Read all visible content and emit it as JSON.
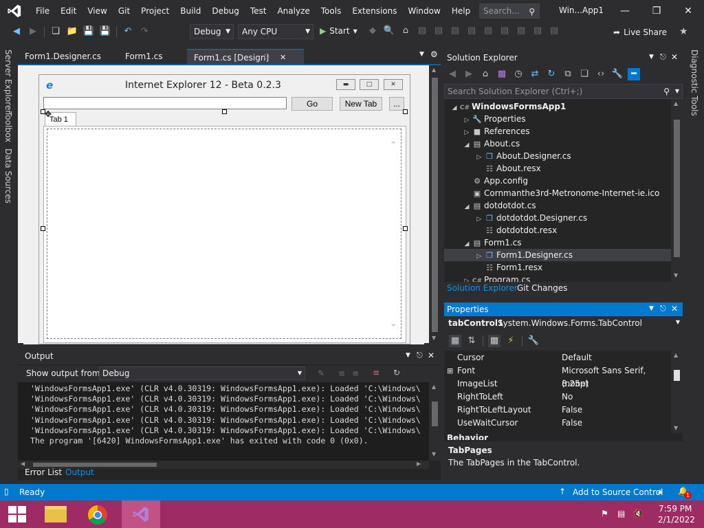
{
  "menubar": {
    "items": [
      "File",
      "Edit",
      "View",
      "Git",
      "Project",
      "Build",
      "Debug",
      "Test",
      "Analyze",
      "Tools",
      "Extensions",
      "Window",
      "Help"
    ],
    "search_placeholder": "Search...",
    "window_title": "Win...App1"
  },
  "toolbar": {
    "config": "Debug",
    "platform": "Any CPU",
    "start_label": "Start",
    "live_share": "Live Share"
  },
  "left_strip": [
    "Server Explorer",
    "Toolbox",
    "Data Sources"
  ],
  "right_strip": "Diagnostic Tools",
  "doc_tabs": [
    "Form1.Designer.cs",
    "Form1.cs",
    "Form1.cs [Design]"
  ],
  "ie_form": {
    "title": "Internet Explorer 12 - Beta 0.2.3",
    "go_label": "Go",
    "newtab_label": "New Tab",
    "more_label": "...",
    "tab1_label": "Tab 1"
  },
  "output": {
    "title": "Output",
    "show_from_label": "Show output from:",
    "source": "Debug",
    "lines": [
      "'WindowsFormsApp1.exe' (CLR v4.0.30319: WindowsFormsApp1.exe): Loaded 'C:\\Windows\\",
      "'WindowsFormsApp1.exe' (CLR v4.0.30319: WindowsFormsApp1.exe): Loaded 'C:\\Windows\\",
      "'WindowsFormsApp1.exe' (CLR v4.0.30319: WindowsFormsApp1.exe): Loaded 'C:\\Windows\\",
      "'WindowsFormsApp1.exe' (CLR v4.0.30319: WindowsFormsApp1.exe): Loaded 'C:\\Windows\\",
      "'WindowsFormsApp1.exe' (CLR v4.0.30319: WindowsFormsApp1.exe): Loaded 'C:\\Windows\\",
      "The program '[6420] WindowsFormsApp1.exe' has exited with code 0 (0x0)."
    ],
    "bottom_tabs": [
      "Error List",
      "Output"
    ]
  },
  "solution_explorer": {
    "title": "Solution Explorer",
    "search_placeholder": "Search Solution Explorer (Ctrl+;)",
    "tree": [
      {
        "label": "WindowsFormsApp1",
        "level": 0,
        "exp": "down",
        "icon": "C#",
        "bold": true
      },
      {
        "label": "Properties",
        "level": 1,
        "exp": "right",
        "icon": "wrench"
      },
      {
        "label": "References",
        "level": 1,
        "exp": "right",
        "icon": "refs"
      },
      {
        "label": "About.cs",
        "level": 1,
        "exp": "down",
        "icon": "form"
      },
      {
        "label": "About.Designer.cs",
        "level": 2,
        "exp": "right",
        "icon": "cs"
      },
      {
        "label": "About.resx",
        "level": 2,
        "exp": "",
        "icon": "resx"
      },
      {
        "label": "App.config",
        "level": 1,
        "exp": "",
        "icon": "config"
      },
      {
        "label": "Cornmanthe3rd-Metronome-Internet-ie.ico",
        "level": 1,
        "exp": "",
        "icon": "ico"
      },
      {
        "label": "dotdotdot.cs",
        "level": 1,
        "exp": "down",
        "icon": "form"
      },
      {
        "label": "dotdotdot.Designer.cs",
        "level": 2,
        "exp": "right",
        "icon": "cs"
      },
      {
        "label": "dotdotdot.resx",
        "level": 2,
        "exp": "",
        "icon": "resx"
      },
      {
        "label": "Form1.cs",
        "level": 1,
        "exp": "down",
        "icon": "form"
      },
      {
        "label": "Form1.Designer.cs",
        "level": 2,
        "exp": "right",
        "icon": "cs",
        "selected": true
      },
      {
        "label": "Form1.resx",
        "level": 2,
        "exp": "",
        "icon": "resx"
      },
      {
        "label": "Program.cs",
        "level": 1,
        "exp": "right",
        "icon": "C#"
      }
    ],
    "tabs": [
      "Solution Explorer",
      "Git Changes"
    ]
  },
  "properties": {
    "title": "Properties",
    "object_name": "tabControl1",
    "object_type": "System.Windows.Forms.TabControl",
    "rows": [
      {
        "name": "Cursor",
        "value": "Default",
        "expand": false
      },
      {
        "name": "Font",
        "value": "Microsoft Sans Serif, 8.25pt",
        "expand": true
      },
      {
        "name": "ImageList",
        "value": "(none)",
        "expand": false
      },
      {
        "name": "RightToLeft",
        "value": "No",
        "expand": false
      },
      {
        "name": "RightToLeftLayout",
        "value": "False",
        "expand": false
      },
      {
        "name": "UseWaitCursor",
        "value": "False",
        "expand": false
      }
    ],
    "category_partial": "Behavior",
    "desc_title": "TabPages",
    "desc_text": "The TabPages in the TabControl."
  },
  "statusbar": {
    "status": "Ready",
    "source_control": "Add to Source Control",
    "notification_count": "1"
  },
  "taskbar": {
    "time": "7:59 PM",
    "date": "2/1/2022"
  },
  "colors": {
    "accent": "#007acc",
    "taskbar": "#9e2b63",
    "ide_bg": "#2d2d30"
  }
}
